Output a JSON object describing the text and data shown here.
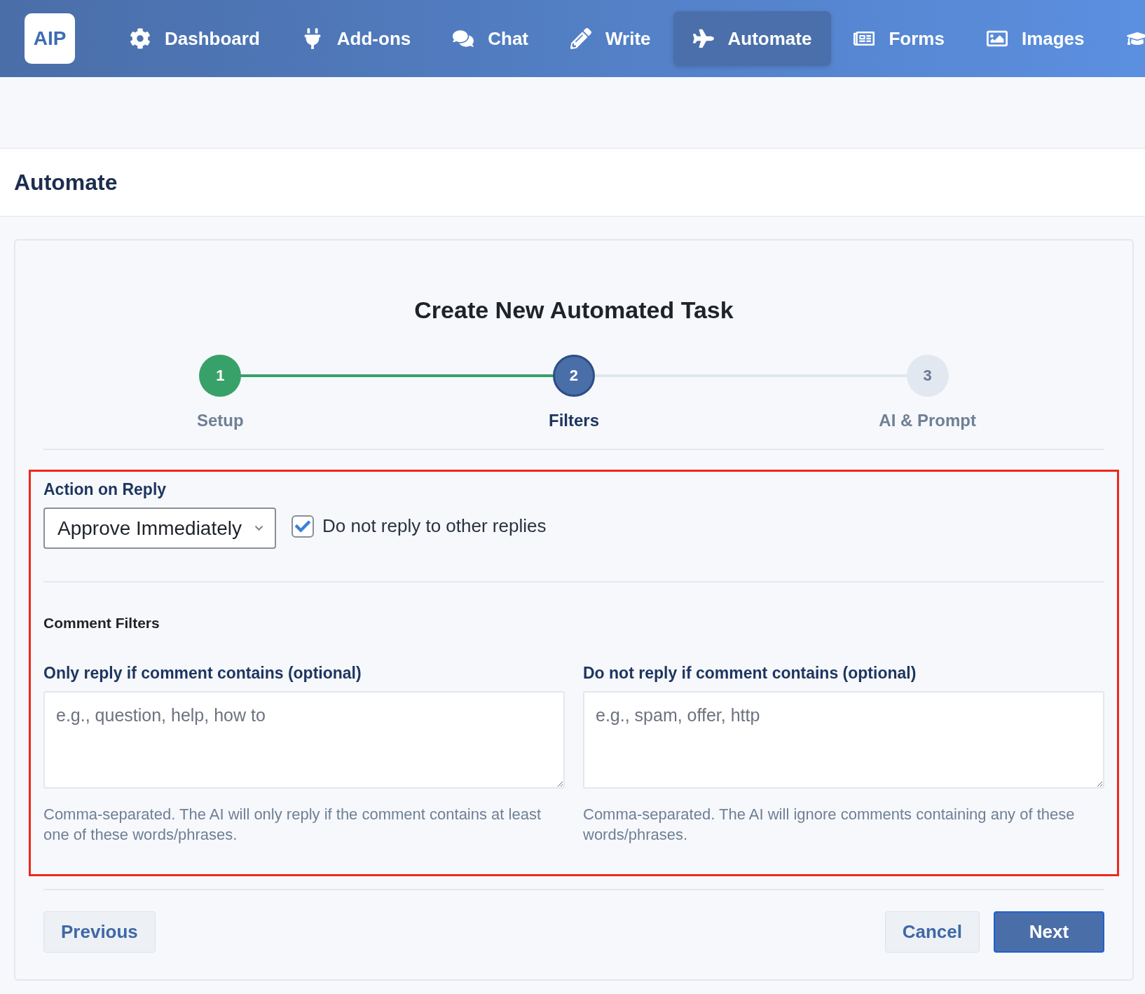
{
  "nav": {
    "logo": "AIP",
    "items": [
      {
        "label": "Dashboard",
        "selected": false
      },
      {
        "label": "Add-ons",
        "selected": false
      },
      {
        "label": "Chat",
        "selected": false
      },
      {
        "label": "Write",
        "selected": false
      },
      {
        "label": "Automate",
        "selected": true
      },
      {
        "label": "Forms",
        "selected": false
      },
      {
        "label": "Images",
        "selected": false
      },
      {
        "selected": false
      }
    ]
  },
  "page_title": "Automate",
  "wizard": {
    "title": "Create New Automated Task",
    "steps": [
      {
        "number": "1",
        "label": "Setup",
        "completed": true,
        "selected": false
      },
      {
        "number": "2",
        "label": "Filters",
        "completed": false,
        "selected": true
      },
      {
        "number": "3",
        "label": "AI & Prompt",
        "completed": false,
        "selected": false
      }
    ],
    "action": {
      "label": "Action on Reply",
      "value": "Approve Immediately",
      "checkbox": {
        "label": "Do not reply to other replies",
        "checked": true
      }
    },
    "filters_heading": "Comment Filters",
    "filters": [
      {
        "label": "Only reply if comment contains (optional)",
        "placeholder": "e.g., question, help, how to",
        "help": "Comma-separated. The AI will only reply if the comment contains at least one of these words/phrases."
      },
      {
        "label": "Do not reply if comment contains (optional)",
        "placeholder": "e.g., spam, offer, http",
        "help": "Comma-separated. The AI will ignore comments containing any of these words/phrases."
      }
    ],
    "buttons": [
      {
        "label": "Previous",
        "kind": "secondary"
      },
      {
        "label": "Cancel",
        "kind": "secondary"
      },
      {
        "label": "Next",
        "kind": "primary"
      }
    ]
  }
}
